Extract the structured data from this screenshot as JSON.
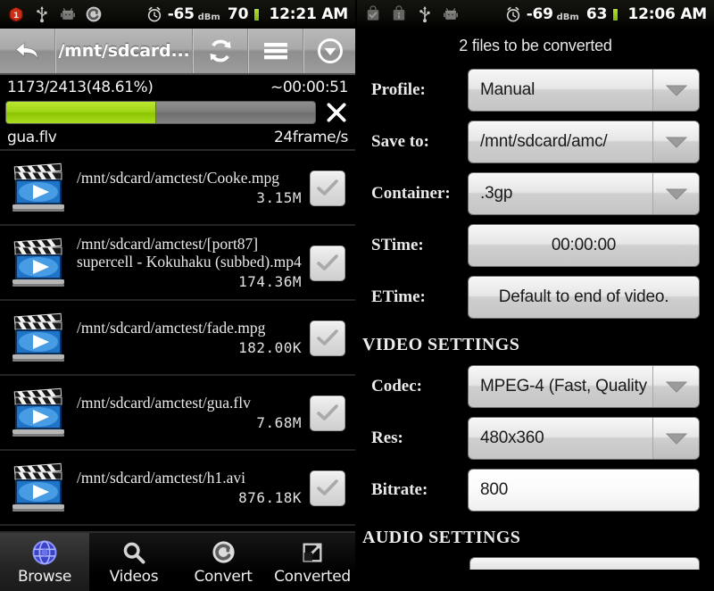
{
  "left": {
    "statusbar": {
      "icons": [
        "notification-badge-icon",
        "usb-icon",
        "android-robot-icon",
        "converter-c-icon"
      ],
      "alarm_icon": "alarm-clock-icon",
      "signal_value": "-65",
      "signal_unit": "dBm",
      "battery_value": "70",
      "clock": "12:21 AM"
    },
    "toolbar": {
      "back_icon": "back-arrow-icon",
      "path": "/mnt/sdcard...",
      "refresh_icon": "refresh-icon",
      "menu_icon": "hamburger-menu-icon",
      "dropdown_icon": "chevron-down-circle-icon"
    },
    "progress": {
      "frames": "1173/2413(48.61%)",
      "percent": 48.61,
      "eta": "~00:00:51",
      "filename": "gua.flv",
      "framerate": "24frame/s",
      "cancel_icon": "close-x-icon"
    },
    "files": [
      {
        "icon": "video-clapperboard-icon",
        "path": "/mnt/sdcard/amctest/Cooke.mpg",
        "size": "3.15M",
        "checked": true
      },
      {
        "icon": "video-clapperboard-icon",
        "path": "/mnt/sdcard/amctest/[port87] supercell - Kokuhaku (subbed).mp4",
        "size": "174.36M",
        "checked": true
      },
      {
        "icon": "video-clapperboard-icon",
        "path": "/mnt/sdcard/amctest/fade.mpg",
        "size": "182.00K",
        "checked": true
      },
      {
        "icon": "video-clapperboard-icon",
        "path": "/mnt/sdcard/amctest/gua.flv",
        "size": "7.68M",
        "checked": true
      },
      {
        "icon": "video-clapperboard-icon",
        "path": "/mnt/sdcard/amctest/h1.avi",
        "size": "876.18K",
        "checked": true
      }
    ],
    "tabs": [
      {
        "label": "Browse",
        "icon": "globe-browse-icon",
        "active": true
      },
      {
        "label": "Videos",
        "icon": "search-magnifier-icon",
        "active": false
      },
      {
        "label": "Convert",
        "icon": "convert-c-icon",
        "active": false
      },
      {
        "label": "Converted",
        "icon": "export-share-icon",
        "active": false
      }
    ]
  },
  "right": {
    "statusbar": {
      "icons": [
        "download-complete-icon",
        "info-bag-icon",
        "usb-icon",
        "android-robot-icon"
      ],
      "alarm_icon": "alarm-clock-icon",
      "signal_value": "-69",
      "signal_unit": "dBm",
      "battery_value": "63",
      "clock": "12:06 AM"
    },
    "files_note": "2  files to be converted",
    "fields": [
      {
        "label": "Profile:",
        "value": "Manual",
        "type": "dropdown",
        "align": "left"
      },
      {
        "label": "Save to:",
        "value": "/mnt/sdcard/amc/",
        "type": "dropdown",
        "align": "left"
      },
      {
        "label": "Container:",
        "value": ".3gp",
        "type": "dropdown",
        "align": "left"
      },
      {
        "label": "STime:",
        "value": "00:00:00",
        "type": "button",
        "align": "center"
      },
      {
        "label": "ETime:",
        "value": "Default to end of video.",
        "type": "button",
        "align": "center"
      }
    ],
    "video_settings_title": "VIDEO SETTINGS",
    "video_fields": [
      {
        "label": "Codec:",
        "value": "MPEG-4 (Fast, Quality",
        "type": "dropdown",
        "align": "left"
      },
      {
        "label": "Res:",
        "value": "480x360",
        "type": "dropdown",
        "align": "left"
      },
      {
        "label": "Bitrate:",
        "value": "800",
        "type": "text",
        "align": "left"
      }
    ],
    "audio_settings_title": "AUDIO SETTINGS"
  },
  "colors": {
    "progress_fill": "#a8dd1e",
    "battery": "#9fd318",
    "panel_bg": "#000000",
    "control_face": "#e6e6e6"
  }
}
